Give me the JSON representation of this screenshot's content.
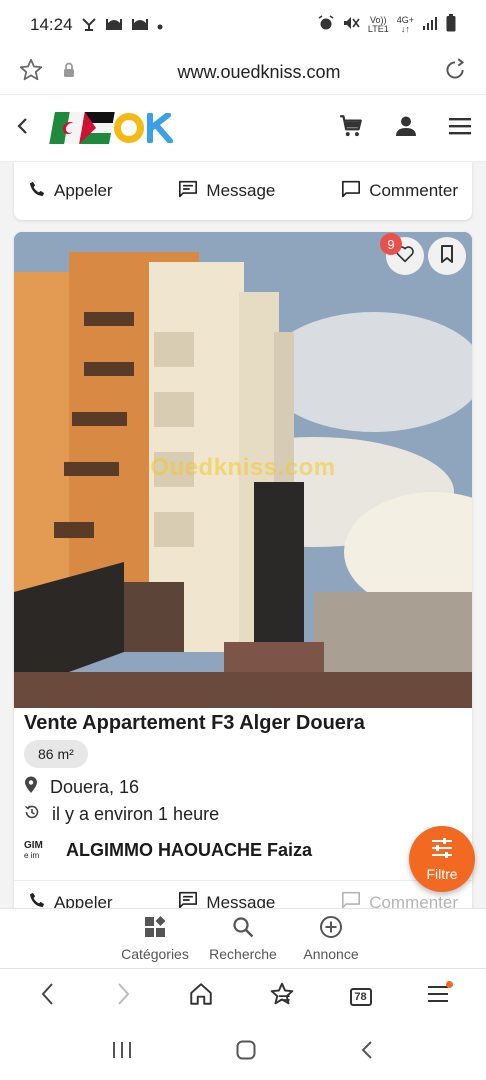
{
  "status_bar": {
    "time": "14:24",
    "net_top": "Vo))",
    "net_bottom": "LTE1",
    "net2_top": "4G+",
    "net2_bottom": "↓↑"
  },
  "browser": {
    "url": "www.ouedkniss.com",
    "tab_count": "78"
  },
  "card_actions": {
    "call": "Appeler",
    "message": "Message",
    "comment": "Commenter"
  },
  "listing": {
    "watermark": "Ouedkniss.com",
    "likes": "9",
    "title": "Vente Appartement F3 Alger Douera",
    "area": "86 m²",
    "location": "Douera, 16",
    "time_ago": "il y a environ 1 heure",
    "seller_logo_line1": "GIM",
    "seller_logo_line2": "e im",
    "seller_name": "ALGIMMO HAOUACHE Faiza"
  },
  "fab": {
    "label": "Filtre"
  },
  "bottom_nav": {
    "categories": "Catégories",
    "search": "Recherche",
    "post": "Annonce"
  },
  "colors": {
    "accent": "#f26a22",
    "badge": "#e9514a",
    "logo_blue": "#3aa0e8",
    "logo_yellow": "#f5b914"
  }
}
